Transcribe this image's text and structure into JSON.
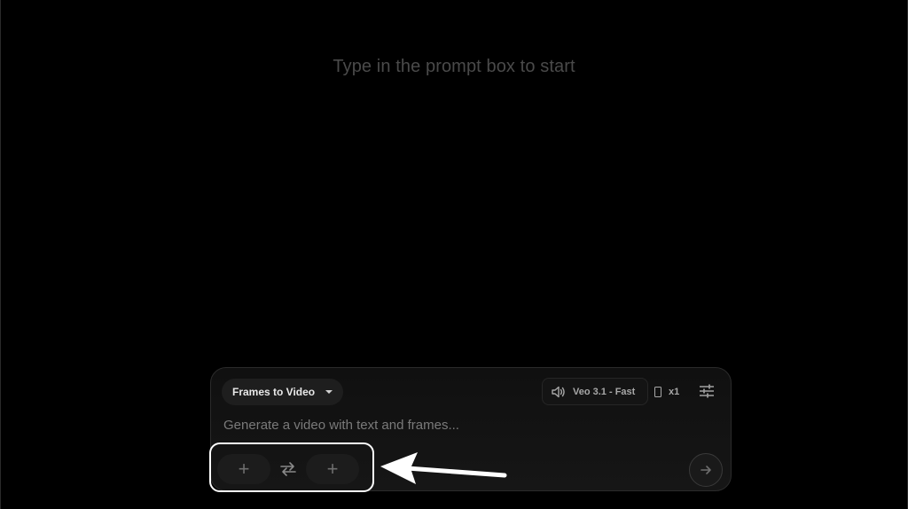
{
  "empty_state": {
    "hint": "Type in the prompt box to start"
  },
  "prompt_box": {
    "mode_label": "Frames to Video",
    "model_label": "Veo 3.1 - Fast",
    "output_count": "x1",
    "placeholder": "Generate a video with text and frames...",
    "start_frame_label": "+",
    "end_frame_label": "+"
  },
  "icons": {
    "mode_dropdown": "chevron-down-icon",
    "audio": "speaker-icon",
    "aspect_ratio": "portrait-ratio-icon",
    "settings": "sliders-icon",
    "swap": "swap-arrows-icon",
    "submit": "arrow-right-icon"
  },
  "annotation": {
    "highlight_color": "#ffffff",
    "arrow_color": "#ffffff"
  }
}
